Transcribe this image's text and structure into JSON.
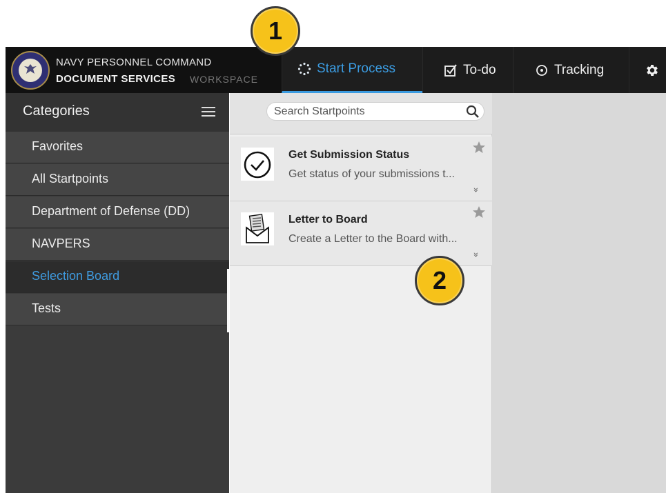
{
  "header": {
    "brand_line1": "NAVY PERSONNEL COMMAND",
    "brand_line2": "DOCUMENT SERVICES",
    "brand_line3": "WORKSPACE",
    "tabs": [
      {
        "label": "Start Process",
        "icon": "spinner-icon",
        "active": true
      },
      {
        "label": "To-do",
        "icon": "checkbox-icon",
        "active": false
      },
      {
        "label": "Tracking",
        "icon": "target-icon",
        "active": false
      }
    ],
    "settings_icon": "gear-icon",
    "active_color": "#3b9be0"
  },
  "sidebar": {
    "title": "Categories",
    "items": [
      {
        "label": "Favorites"
      },
      {
        "label": "All Startpoints"
      },
      {
        "label": "Department of Defense (DD)"
      },
      {
        "label": "NAVPERS"
      },
      {
        "label": "Selection Board",
        "active": true
      },
      {
        "label": "Tests"
      }
    ]
  },
  "search": {
    "placeholder": "Search Startpoints"
  },
  "cards": [
    {
      "title": "Get Submission Status",
      "description": "Get status of your submissions t...",
      "icon": "check-circle-icon"
    },
    {
      "title": "Letter to Board",
      "description": "Create a Letter to the Board with...",
      "icon": "letter-envelope-icon"
    }
  ],
  "callouts": [
    {
      "number": "1"
    },
    {
      "number": "2"
    }
  ],
  "colors": {
    "callout": "#f6c21a",
    "header_bg": "#111111",
    "sidebar_bg": "#3b3b3b"
  }
}
